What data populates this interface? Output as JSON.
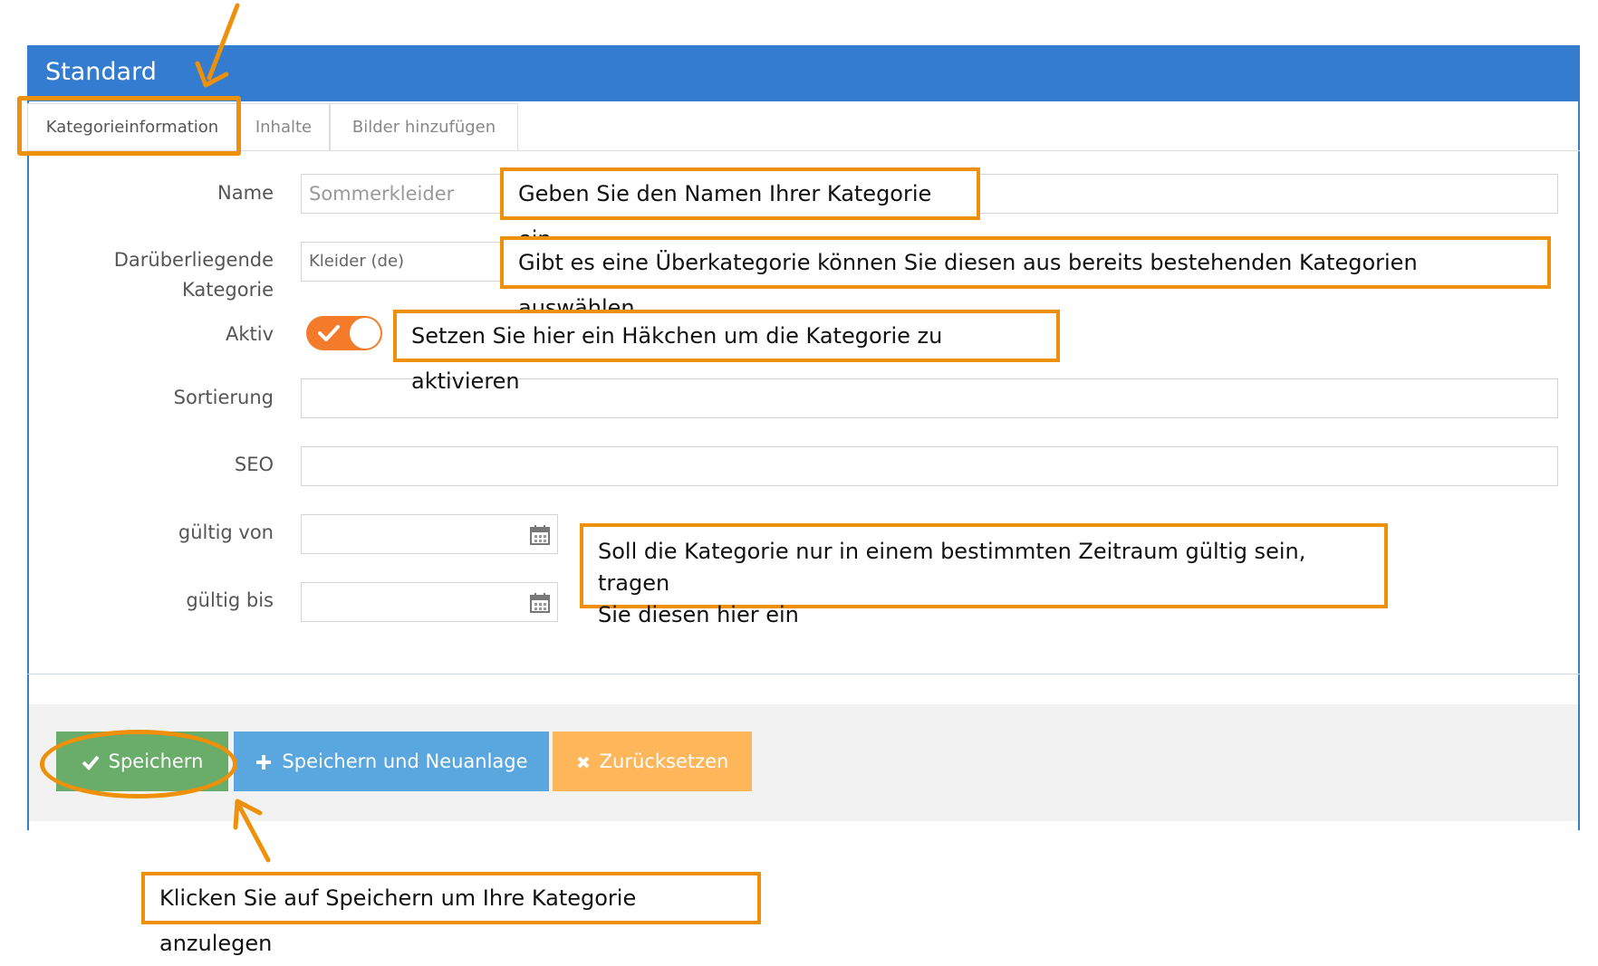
{
  "panel": {
    "title": "Standard"
  },
  "tabs": [
    {
      "label": "Kategorieinformation"
    },
    {
      "label": "Inhalte"
    },
    {
      "label": "Bilder hinzufügen"
    }
  ],
  "form": {
    "name": {
      "label": "Name",
      "value": "Sommerkleider"
    },
    "parent": {
      "label_line1": "Darüberliegende",
      "label_line2": "Kategorie",
      "value": "Kleider (de)"
    },
    "active": {
      "label": "Aktiv",
      "checked": true
    },
    "sorting": {
      "label": "Sortierung",
      "value": ""
    },
    "seo": {
      "label": "SEO",
      "value": ""
    },
    "valid_from": {
      "label": "gültig von",
      "value": ""
    },
    "valid_to": {
      "label": "gültig bis",
      "value": ""
    }
  },
  "buttons": {
    "save": "Speichern",
    "save_new": "Speichern und Neuanlage",
    "reset": "Zurücksetzen"
  },
  "callouts": {
    "name": "Geben Sie den Namen Ihrer Kategorie ein",
    "parent": "Gibt es eine Überkategorie können Sie diesen aus bereits bestehenden Kategorien auswählen",
    "active": "Setzen Sie hier ein Häkchen um die Kategorie zu aktivieren",
    "validity_line1": "Soll die Kategorie nur in einem bestimmten Zeitraum gültig sein, tragen",
    "validity_line2": "Sie diesen hier ein",
    "save": "Klicken Sie auf Speichern um Ihre Kategorie anzulegen"
  },
  "colors": {
    "header": "#337ccf",
    "accent_orange": "#ee9009",
    "toggle": "#f37b2a",
    "save": "#6aac6a",
    "save_new": "#5aa7e0",
    "reset": "#fdb65a"
  }
}
